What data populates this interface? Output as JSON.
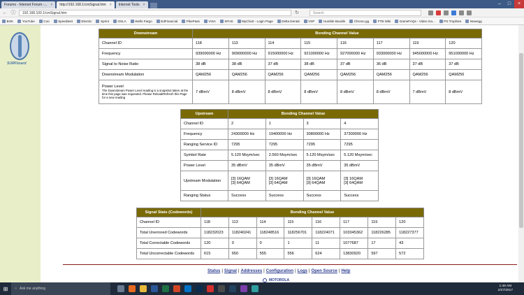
{
  "browser": {
    "tabs": [
      {
        "label": "Forums - Internet Forum -...",
        "active": false
      },
      {
        "label": "http://192.168.1/cmSignal.htm",
        "active": true
      },
      {
        "label": "Internet Tools",
        "active": false
      }
    ],
    "url": "192.168.100.1/cmSignal.htm",
    "search_placeholder": "Search",
    "bookmarks": [
      "BOK",
      "YouTube",
      "Coo",
      "Speedtest",
      "Electric",
      "Sprint",
      "OSLA",
      "Wells Fargo",
      "EdFinancial",
      "PikePass",
      "VISA",
      "SFHS",
      "MyChart - Login Page",
      "Delta Dental",
      "VSP",
      "Humble Bundle",
      "Chrono.gg",
      "FTB Wiki",
      "GameFAQs - Video Ga...",
      "PS Trophies",
      "Newegg"
    ]
  },
  "logo_text": "SURFboard",
  "downstream": {
    "header": "Downstream",
    "group_header": "Bonding Channel Value",
    "rows": [
      {
        "label": "Channel ID",
        "values": [
          "118",
          "113",
          "114",
          "115",
          "116",
          "117",
          "119",
          "120"
        ]
      },
      {
        "label": "Frequency",
        "values": [
          "939000000 Hz",
          "909000000 Hz",
          "915000000 Hz",
          "921000000 Hz",
          "927000000 Hz",
          "933000000 Hz",
          "945000000 Hz",
          "951000000 Hz"
        ]
      },
      {
        "label": "Signal to Noise Ratio",
        "values": [
          "38 dB",
          "38 dB",
          "37 dB",
          "38 dB",
          "37 dB",
          "36 dB",
          "37 dB",
          "37 dB"
        ]
      },
      {
        "label": "Downstream Modulation",
        "values": [
          "QAM256",
          "QAM256",
          "QAM256",
          "QAM256",
          "QAM256",
          "QAM256",
          "QAM256",
          "QAM256"
        ]
      },
      {
        "label": "Power Level",
        "note": "The Downstream Power Level reading is a snapshot taken at the time this page was requested. Please Reload/Refresh this Page for a new reading",
        "values": [
          "7 dBmV",
          "8 dBmV",
          "8 dBmV",
          "8 dBmV",
          "8 dBmV",
          "8 dBmV",
          "7 dBmV",
          "8 dBmV"
        ]
      }
    ]
  },
  "upstream": {
    "header": "Upstream",
    "group_header": "Bonding Channel Value",
    "rows": [
      {
        "label": "Channel ID",
        "values": [
          "2",
          "1",
          "3",
          "4"
        ]
      },
      {
        "label": "Frequency",
        "values": [
          "24300000 Hz",
          "19400000 Hz",
          "30800000 Hz",
          "37300000 Hz"
        ]
      },
      {
        "label": "Ranging Service ID",
        "values": [
          "7295",
          "7295",
          "7295",
          "7295"
        ]
      },
      {
        "label": "Symbol Rate",
        "values": [
          "5.120 Msym/sec",
          "2.560 Msym/sec",
          "5.120 Msym/sec",
          "5.120 Msym/sec"
        ]
      },
      {
        "label": "Power Level",
        "values": [
          "35 dBmV",
          "35 dBmV",
          "35 dBmV",
          "35 dBmV"
        ]
      },
      {
        "label": "Upstream Modulation",
        "values": [
          "[3] 16QAM\n[3] 64QAM",
          "[3] 16QAM\n[3] 64QAM",
          "[3] 16QAM\n[3] 64QAM",
          "[3] 16QAM\n[3] 64QAM"
        ]
      },
      {
        "label": "Ranging Status",
        "values": [
          "Success",
          "Success",
          "Success",
          "Success"
        ]
      }
    ]
  },
  "stats": {
    "header": "Signal Stats (Codewords)",
    "group_header": "Bonding Channel Value",
    "rows": [
      {
        "label": "Channel ID",
        "values": [
          "118",
          "113",
          "114",
          "115",
          "116",
          "117",
          "119",
          "120"
        ]
      },
      {
        "label": "Total Unerrored Codewords",
        "values": [
          "118232023",
          "118240241",
          "118248516",
          "118256701",
          "118224071",
          "103345362",
          "118226285",
          "118227377"
        ]
      },
      {
        "label": "Total Correctable Codewords",
        "values": [
          "120",
          "0",
          "0",
          "1",
          "11",
          "1077687",
          "17",
          "43"
        ]
      },
      {
        "label": "Total Uncorrectable Codewords",
        "values": [
          "615",
          "650",
          "555",
          "556",
          "624",
          "13830920",
          "597",
          "572"
        ]
      }
    ]
  },
  "footer": {
    "links": [
      "Status",
      "Signal",
      "Addresses",
      "Configuration",
      "Logs",
      "Open Source",
      "Help"
    ],
    "brand": "MOTOROLA"
  },
  "taskbar": {
    "search_placeholder": "Ask me anything",
    "time": "1:49 AM",
    "date": "2/27/2017"
  }
}
